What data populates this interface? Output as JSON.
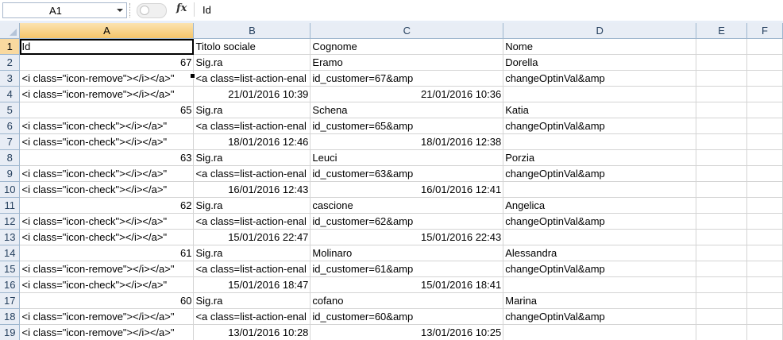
{
  "formula_bar": {
    "name_box": "A1",
    "fx_label": "fx",
    "formula_value": "Id"
  },
  "columns": [
    "A",
    "B",
    "C",
    "D",
    "E",
    "F"
  ],
  "rows": [
    {
      "num": "1",
      "a": "Id",
      "b": "Titolo sociale",
      "c": "Cognome",
      "d": "Nome",
      "align": [
        "l",
        "l",
        "l",
        "l"
      ]
    },
    {
      "num": "2",
      "a": "67",
      "b": "Sig.ra",
      "c": "Eramo",
      "d": "Dorella",
      "align": [
        "r",
        "l",
        "l",
        "l"
      ]
    },
    {
      "num": "3",
      "a": "<i class=\"icon-remove\"></i></a>\"",
      "b": "<a class=list-action-enal",
      "c": "id_customer=67&amp",
      "d": "changeOptinVal&amp",
      "align": [
        "l",
        "l",
        "l",
        "l"
      ]
    },
    {
      "num": "4",
      "a": "<i class=\"icon-remove\"></i></a>\"",
      "b": "21/01/2016 10:39",
      "c": "21/01/2016 10:36",
      "d": "",
      "align": [
        "l",
        "r",
        "r",
        "l"
      ]
    },
    {
      "num": "5",
      "a": "65",
      "b": "Sig.ra",
      "c": "Schena",
      "d": "Katia",
      "align": [
        "r",
        "l",
        "l",
        "l"
      ]
    },
    {
      "num": "6",
      "a": "<i class=\"icon-check\"></i></a>\"",
      "b": "<a class=list-action-enal",
      "c": "id_customer=65&amp",
      "d": "changeOptinVal&amp",
      "align": [
        "l",
        "l",
        "l",
        "l"
      ]
    },
    {
      "num": "7",
      "a": "<i class=\"icon-check\"></i></a>\"",
      "b": "18/01/2016 12:46",
      "c": "18/01/2016 12:38",
      "d": "",
      "align": [
        "l",
        "r",
        "r",
        "l"
      ]
    },
    {
      "num": "8",
      "a": "63",
      "b": "Sig.ra",
      "c": "Leuci",
      "d": "Porzia",
      "align": [
        "r",
        "l",
        "l",
        "l"
      ]
    },
    {
      "num": "9",
      "a": "<i class=\"icon-check\"></i></a>\"",
      "b": "<a class=list-action-enal",
      "c": "id_customer=63&amp",
      "d": "changeOptinVal&amp",
      "align": [
        "l",
        "l",
        "l",
        "l"
      ]
    },
    {
      "num": "10",
      "a": "<i class=\"icon-check\"></i></a>\"",
      "b": "16/01/2016 12:43",
      "c": "16/01/2016 12:41",
      "d": "",
      "align": [
        "l",
        "r",
        "r",
        "l"
      ]
    },
    {
      "num": "11",
      "a": "62",
      "b": "Sig.ra",
      "c": "cascione",
      "d": "Angelica",
      "align": [
        "r",
        "l",
        "l",
        "l"
      ]
    },
    {
      "num": "12",
      "a": "<i class=\"icon-check\"></i></a>\"",
      "b": "<a class=list-action-enal",
      "c": "id_customer=62&amp",
      "d": "changeOptinVal&amp",
      "align": [
        "l",
        "l",
        "l",
        "l"
      ]
    },
    {
      "num": "13",
      "a": "<i class=\"icon-check\"></i></a>\"",
      "b": "15/01/2016 22:47",
      "c": "15/01/2016 22:43",
      "d": "",
      "align": [
        "l",
        "r",
        "r",
        "l"
      ]
    },
    {
      "num": "14",
      "a": "61",
      "b": "Sig.ra",
      "c": "Molinaro",
      "d": "Alessandra",
      "align": [
        "r",
        "l",
        "l",
        "l"
      ]
    },
    {
      "num": "15",
      "a": "<i class=\"icon-remove\"></i></a>\"",
      "b": "<a class=list-action-enal",
      "c": "id_customer=61&amp",
      "d": "changeOptinVal&amp",
      "align": [
        "l",
        "l",
        "l",
        "l"
      ]
    },
    {
      "num": "16",
      "a": "<i class=\"icon-check\"></i></a>\"",
      "b": "15/01/2016 18:47",
      "c": "15/01/2016 18:41",
      "d": "",
      "align": [
        "l",
        "r",
        "r",
        "l"
      ]
    },
    {
      "num": "17",
      "a": "60",
      "b": "Sig.ra",
      "c": "cofano",
      "d": "Marina",
      "align": [
        "r",
        "l",
        "l",
        "l"
      ]
    },
    {
      "num": "18",
      "a": "<i class=\"icon-remove\"></i></a>\"",
      "b": "<a class=list-action-enal",
      "c": "id_customer=60&amp",
      "d": "changeOptinVal&amp",
      "align": [
        "l",
        "l",
        "l",
        "l"
      ]
    },
    {
      "num": "19",
      "a": "<i class=\"icon-remove\"></i></a>\"",
      "b": "13/01/2016 10:28",
      "c": "13/01/2016 10:25",
      "d": "",
      "align": [
        "l",
        "r",
        "r",
        "l"
      ]
    }
  ]
}
